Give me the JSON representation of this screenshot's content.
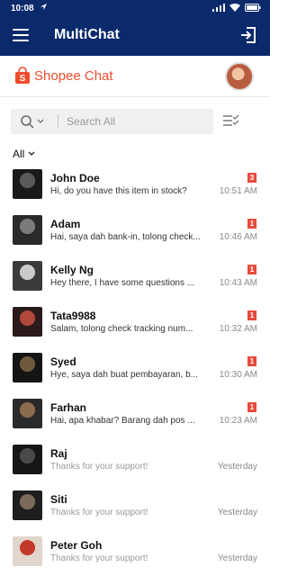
{
  "status_bar": {
    "time": "10:08"
  },
  "app_bar": {
    "title": "MultiChat"
  },
  "brand": {
    "label": "Shopee Chat",
    "color": "#ee4d2d"
  },
  "search": {
    "placeholder": "Search All"
  },
  "filter": {
    "label": "All"
  },
  "chats": [
    {
      "name": "John Doe",
      "message": "Hi, do you have this item in stock?",
      "time": "10:51 AM",
      "unread": "3",
      "colors": [
        "#5a5a5a",
        "#1a1a1a"
      ]
    },
    {
      "name": "Adam",
      "message": "Hai, saya dah bank-in, tolong check...",
      "time": "10:46 AM",
      "unread": "1",
      "colors": [
        "#7a7a7a",
        "#2a2a2a"
      ]
    },
    {
      "name": "Kelly Ng",
      "message": "Hey there, I have some questions ...",
      "time": "10:43 AM",
      "unread": "1",
      "colors": [
        "#c9c9c9",
        "#3a3a3a"
      ]
    },
    {
      "name": "Tata9988",
      "message": "Salam, tolong check tracking num...",
      "time": "10:32 AM",
      "unread": "1",
      "colors": [
        "#b0483c",
        "#2b1a1a"
      ]
    },
    {
      "name": "Syed",
      "message": "Hye, saya dah buat pembayaran, b...",
      "time": "10:30 AM",
      "unread": "1",
      "colors": [
        "#6e5a3a",
        "#141414"
      ]
    },
    {
      "name": "Farhan",
      "message": "Hai, apa khabar? Barang dah pos ...",
      "time": "10:23 AM",
      "unread": "1",
      "colors": [
        "#8c6b4f",
        "#2a2a2a"
      ]
    },
    {
      "name": "Raj",
      "message": "Thanks for your support!",
      "time": "Yesterday",
      "unread": "",
      "colors": [
        "#4a4a4a",
        "#161616"
      ]
    },
    {
      "name": "Siti",
      "message": "Thanks for your support!",
      "time": "Yesterday",
      "unread": "",
      "colors": [
        "#7a6a5a",
        "#1e1e1e"
      ]
    },
    {
      "name": "Peter Goh",
      "message": "Thanks for your support!",
      "time": "Yesterday",
      "unread": "",
      "colors": [
        "#c43a2a",
        "#e0d6cc"
      ]
    }
  ]
}
